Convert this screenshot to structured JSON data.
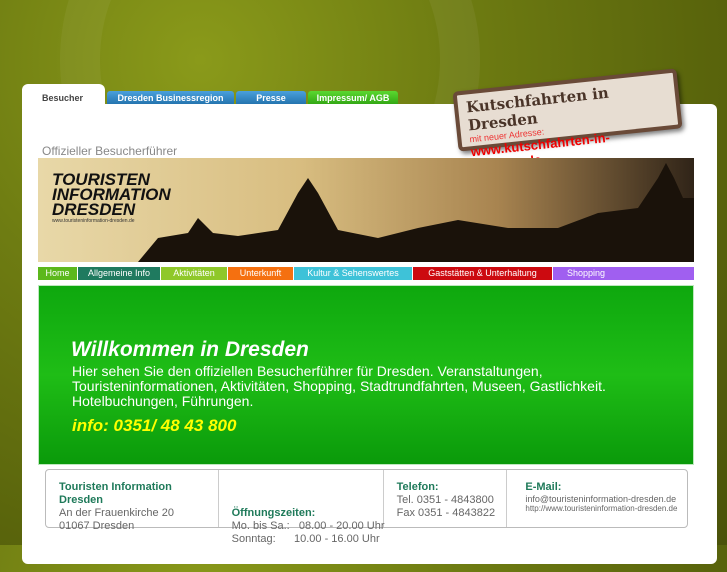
{
  "tabs": [
    {
      "label": "Besucher"
    },
    {
      "label": "Dresden Businessregion"
    },
    {
      "label": "Presse"
    },
    {
      "label": "Impressum/ AGB"
    }
  ],
  "sign": {
    "title": "Kutschfahrten in Dresden",
    "note": "mit neuer Adresse:",
    "url": "www.kutschfahrten-in-dresden.de"
  },
  "subtitle": "Offizieller Besucherführer",
  "banner": {
    "logo1": "TOURISTEN",
    "logo2": "INFORMATION",
    "logo3": "DRESDEN",
    "url": "www.touristeninformation-dresden.de"
  },
  "nav": [
    {
      "label": "Home",
      "color": "#5cb81c"
    },
    {
      "label": "Allgemeine Info",
      "color": "#1f7a5f"
    },
    {
      "label": "Aktivitäten",
      "color": "#8fc82a"
    },
    {
      "label": "Unterkunft",
      "color": "#f57010"
    },
    {
      "label": "Kultur & Sehenswertes",
      "color": "#3ec2d8"
    },
    {
      "label": "Gaststätten & Unterhaltung",
      "color": "#cc0a10"
    },
    {
      "label": "Shopping",
      "color": "#a05ff0"
    }
  ],
  "welcome": {
    "title": "Willkommen in Dresden",
    "text": "Hier sehen Sie den offiziellen Besucherführer für Dresden. Veranstaltungen, Touristeninformationen, Aktivitäten, Shopping, Stadtrundfahrten, Museen, Gastlichkeit. Hotelbuchungen, Führungen.",
    "info": "info: 0351/ 48 43 800"
  },
  "footer": {
    "address": {
      "title": "Touristen Information Dresden",
      "line1": "An der Frauenkirche 20",
      "line2": "01067 Dresden"
    },
    "hours": {
      "title": "Öffnungszeiten:",
      "line1": "Mo. bis Sa.:   08.00 - 20.00 Uhr",
      "line2": "Sonntag:      10.00 - 16.00 Uhr"
    },
    "phone": {
      "title": "Telefon:",
      "line1": "Tel. 0351 - 4843800",
      "line2": "Fax 0351 - 4843822"
    },
    "email": {
      "title": "E-Mail:",
      "line1": "info@touristeninformation-dresden.de",
      "line2": "http://www.touristeninformation-dresden.de"
    }
  }
}
